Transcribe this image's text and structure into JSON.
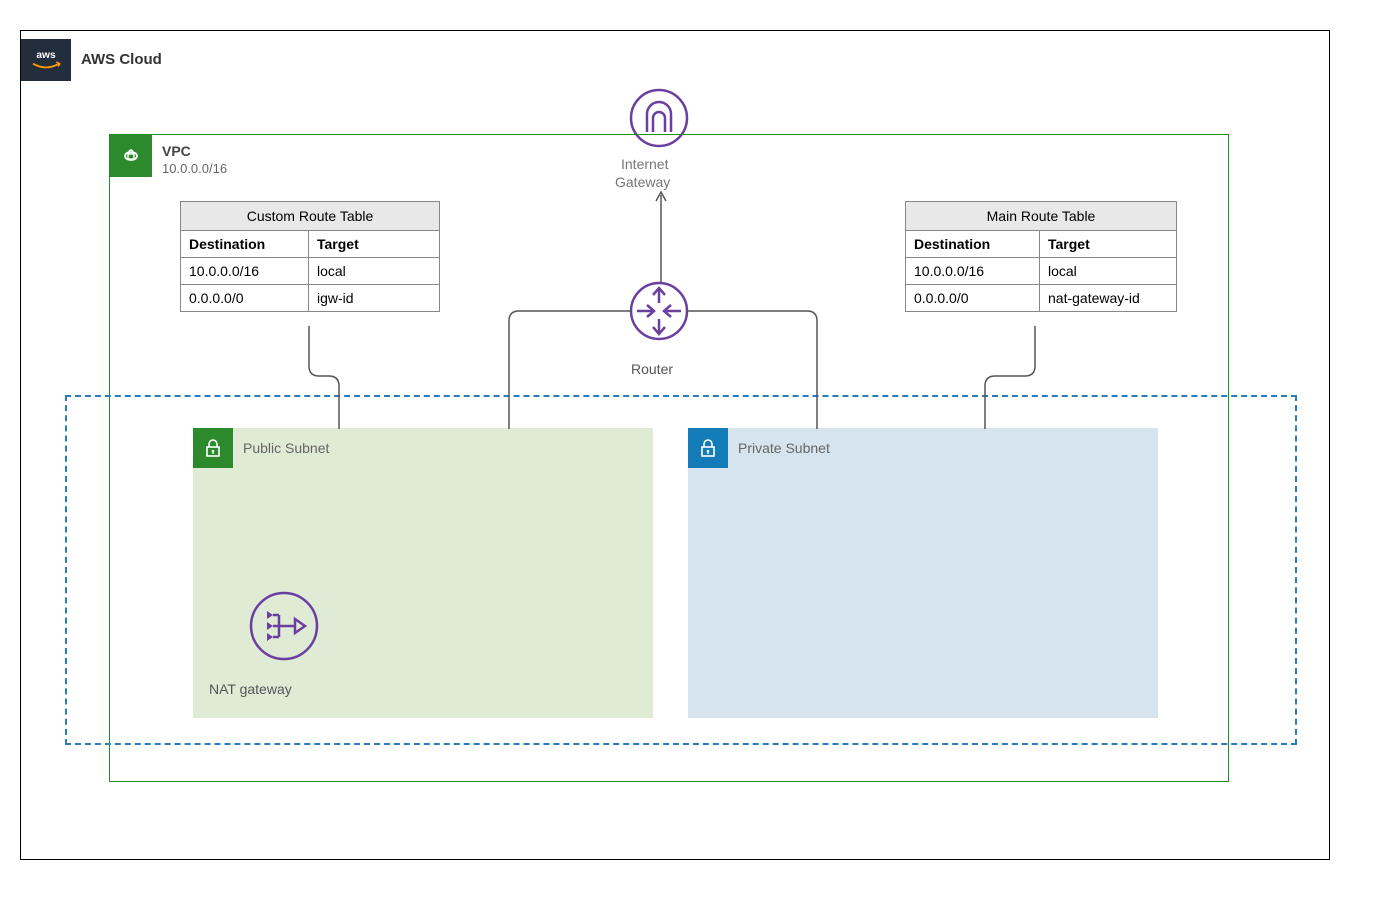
{
  "cloud": {
    "label": "AWS Cloud",
    "logo_text": "aws"
  },
  "vpc": {
    "title": "VPC",
    "cidr": "10.0.0.0/16"
  },
  "internet_gateway": {
    "label_line1": "Internet",
    "label_line2": "Gateway"
  },
  "router": {
    "label": "Router"
  },
  "custom_route_table": {
    "title": "Custom Route Table",
    "headers": {
      "destination": "Destination",
      "target": "Target"
    },
    "rows": [
      {
        "destination": "10.0.0.0/16",
        "target": "local"
      },
      {
        "destination": "0.0.0.0/0",
        "target": "igw-id"
      }
    ]
  },
  "main_route_table": {
    "title": "Main Route Table",
    "headers": {
      "destination": "Destination",
      "target": "Target"
    },
    "rows": [
      {
        "destination": "10.0.0.0/16",
        "target": "local"
      },
      {
        "destination": "0.0.0.0/0",
        "target": "nat-gateway-id"
      }
    ]
  },
  "public_subnet": {
    "label": "Public Subnet"
  },
  "private_subnet": {
    "label": "Private Subnet"
  },
  "nat_gateway": {
    "label": "NAT gateway"
  }
}
